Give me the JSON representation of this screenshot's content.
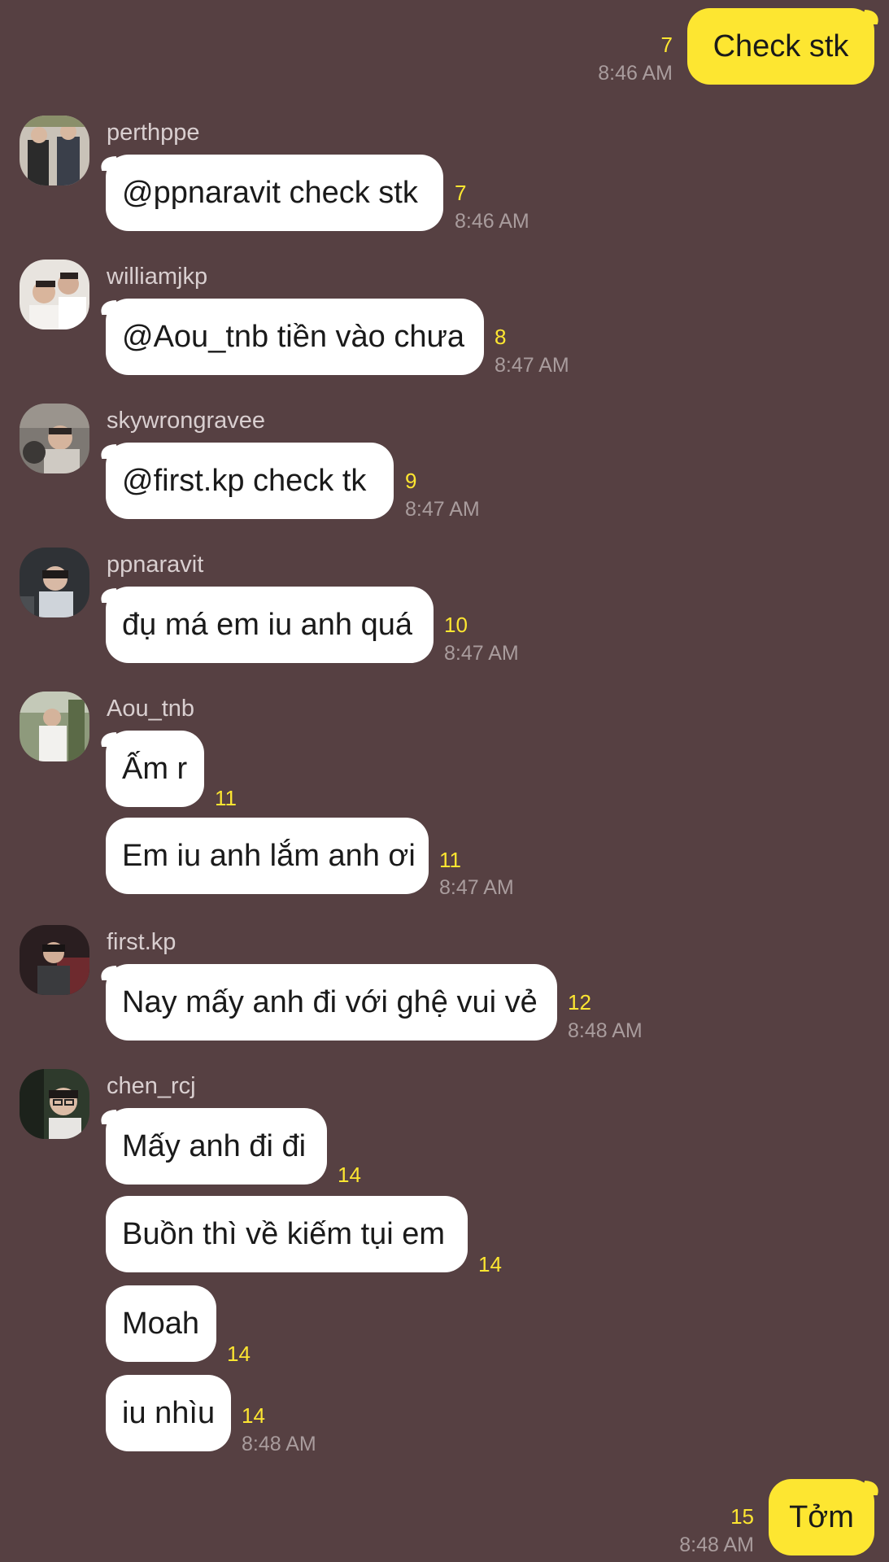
{
  "colors": {
    "background": "#564042",
    "bubble_incoming": "#ffffff",
    "bubble_outgoing": "#fde631",
    "unread_count": "#fde631",
    "timestamp": "#a99c9d",
    "sender_name": "#d9cfd0"
  },
  "messages": {
    "out1": {
      "text": "Check stk",
      "unread": "7",
      "time": "8:46 AM"
    },
    "g1": {
      "sender": "perthppe",
      "m1": {
        "text": "@ppnaravit check stk",
        "unread": "7"
      },
      "time": "8:46 AM"
    },
    "g2": {
      "sender": "williamjkp",
      "m1": {
        "text": "@Aou_tnb tiền vào chưa",
        "unread": "8"
      },
      "time": "8:47 AM"
    },
    "g3": {
      "sender": "skywrongravee",
      "m1": {
        "text": "@first.kp check tk",
        "unread": "9"
      },
      "time": "8:47 AM"
    },
    "g4": {
      "sender": "ppnaravit",
      "m1": {
        "text": "đụ má em iu anh quá",
        "unread": "10"
      },
      "time": "8:47 AM"
    },
    "g5": {
      "sender": "Aou_tnb",
      "m1": {
        "text": "Ấm r",
        "unread": "11"
      },
      "m2": {
        "text": "Em iu anh lắm anh ơi",
        "unread": "11"
      },
      "time": "8:47 AM"
    },
    "g6": {
      "sender": "first.kp",
      "m1": {
        "text": "Nay mấy anh đi với ghệ vui vẻ",
        "unread": "12"
      },
      "time": "8:48 AM"
    },
    "g7": {
      "sender": "chen_rcj",
      "m1": {
        "text": "Mấy anh đi đi",
        "unread": "14"
      },
      "m2": {
        "text": "Buồn thì về kiếm tụi em",
        "unread": "14"
      },
      "m3": {
        "text": "Moah",
        "unread": "14"
      },
      "m4": {
        "text": "iu nhìu",
        "unread": "14"
      },
      "time": "8:48 AM"
    },
    "out2": {
      "text": "Tởm",
      "unread": "15",
      "time": "8:48 AM"
    }
  }
}
